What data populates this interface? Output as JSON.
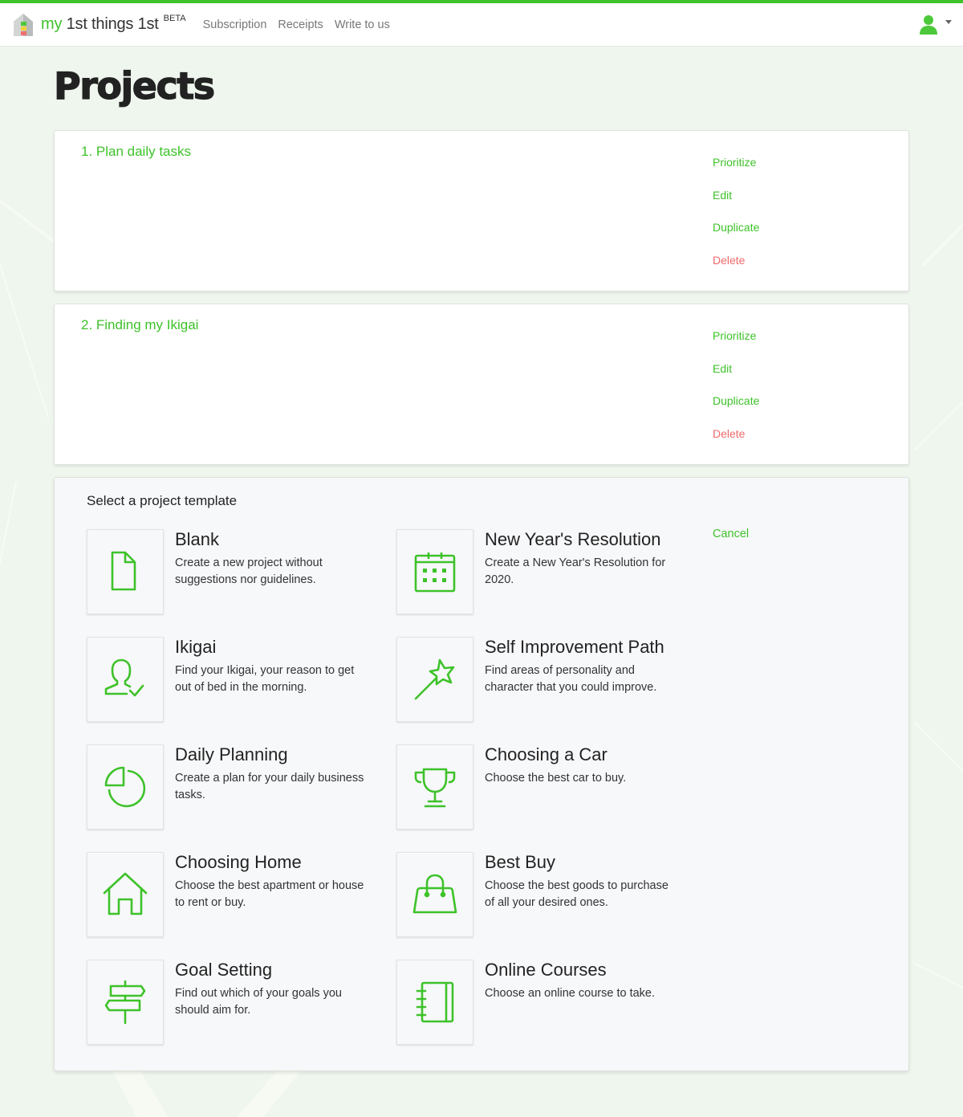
{
  "colors": {
    "accent": "#3ec22a",
    "danger": "#f06a6a",
    "background": "#eff6ee",
    "panel": "#f7f8fa"
  },
  "navbar": {
    "brand": {
      "prefix": "my",
      "name": "1st things 1st",
      "badge": "BETA",
      "logo_icon": "house-logo-icon"
    },
    "links": [
      {
        "label": "Subscription"
      },
      {
        "label": "Receipts"
      },
      {
        "label": "Write to us"
      }
    ],
    "user_menu": {
      "icon": "user-icon",
      "dropdown_icon": "caret-down-icon"
    }
  },
  "page": {
    "title": "Projects"
  },
  "projects": [
    {
      "title": "1. Plan daily tasks",
      "actions": [
        {
          "label": "Prioritize",
          "type": "normal"
        },
        {
          "label": "Edit",
          "type": "normal"
        },
        {
          "label": "Duplicate",
          "type": "normal"
        },
        {
          "label": "Delete",
          "type": "danger"
        }
      ]
    },
    {
      "title": "2. Finding my Ikigai",
      "actions": [
        {
          "label": "Prioritize",
          "type": "normal"
        },
        {
          "label": "Edit",
          "type": "normal"
        },
        {
          "label": "Duplicate",
          "type": "normal"
        },
        {
          "label": "Delete",
          "type": "danger"
        }
      ]
    }
  ],
  "template_picker": {
    "heading": "Select a project template",
    "cancel_label": "Cancel",
    "templates": [
      {
        "name": "Blank",
        "description": "Create a new project without suggestions nor guidelines.",
        "icon": "document-icon"
      },
      {
        "name": "New Year's Resolution",
        "description": "Create a New Year's Resolution for 2020.",
        "icon": "calendar-icon"
      },
      {
        "name": "Ikigai",
        "description": "Find your Ikigai, your reason to get out of bed in the morning.",
        "icon": "user-check-icon"
      },
      {
        "name": "Self Improvement Path",
        "description": "Find areas of personality and character that you could improve.",
        "icon": "magic-wand-icon"
      },
      {
        "name": "Daily Planning",
        "description": "Create a plan for your daily business tasks.",
        "icon": "pie-chart-icon"
      },
      {
        "name": "Choosing a Car",
        "description": "Choose the best car to buy.",
        "icon": "trophy-icon"
      },
      {
        "name": "Choosing Home",
        "description": "Choose the best apartment or house to rent or buy.",
        "icon": "house-icon"
      },
      {
        "name": "Best Buy",
        "description": "Choose the best goods to purchase of all your desired ones.",
        "icon": "shopping-bag-icon"
      },
      {
        "name": "Goal Setting",
        "description": "Find out which of your goals you should aim for.",
        "icon": "signpost-icon"
      },
      {
        "name": "Online Courses",
        "description": "Choose an online course to take.",
        "icon": "notebook-icon"
      }
    ]
  }
}
